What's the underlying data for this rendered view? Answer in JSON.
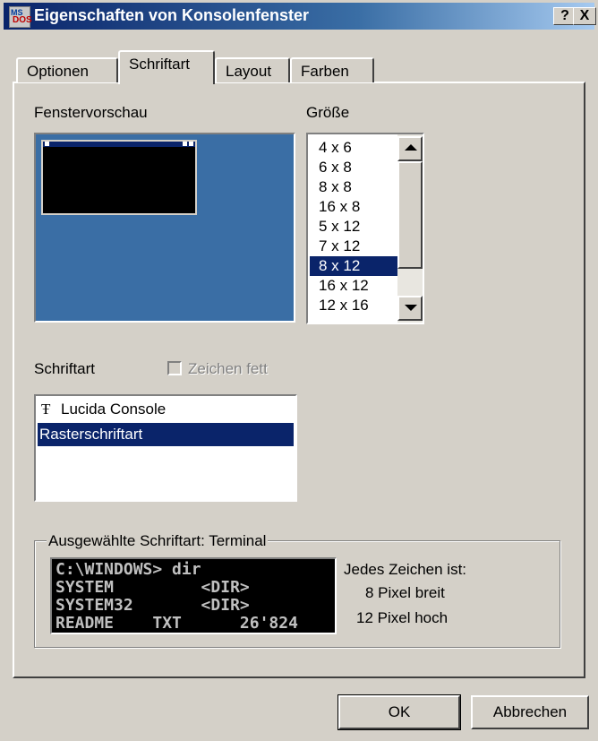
{
  "window": {
    "title": "Eigenschaften von Konsolenfenster",
    "icon_ms": "MS",
    "icon_dos": "DOS",
    "help_label": "?",
    "close_label": "X"
  },
  "tabs": [
    {
      "label": "Optionen",
      "active": false
    },
    {
      "label": "Schriftart",
      "active": true
    },
    {
      "label": "Layout",
      "active": false
    },
    {
      "label": "Farben",
      "active": false
    }
  ],
  "preview": {
    "label": "Fenstervorschau"
  },
  "size": {
    "label": "Größe",
    "items": [
      "4 x 6",
      "6 x 8",
      "8 x 8",
      "16 x 8",
      "5 x 12",
      "7 x 12",
      "8 x 12",
      "16 x 12",
      "12 x 16"
    ],
    "selected": "8 x 12"
  },
  "font": {
    "label": "Schriftart",
    "bold_label": "Zeichen fett",
    "bold_checked": false,
    "items": [
      {
        "name": "Lucida Console",
        "icon": "truetype-icon"
      },
      {
        "name": "Rasterschriftart",
        "icon": ""
      }
    ],
    "selected": "Rasterschriftart"
  },
  "selected_font": {
    "legend": "Ausgewählte Schriftart: Terminal",
    "sample_lines": [
      "C:\\WINDOWS> dir",
      "SYSTEM         <DIR>",
      "SYSTEM32       <DIR>",
      "README    TXT      26'824"
    ],
    "info_heading": "Jedes Zeichen ist:",
    "width_text": "8 Pixel breit",
    "height_text": "12 Pixel hoch"
  },
  "buttons": {
    "ok": "OK",
    "cancel": "Abbrechen"
  },
  "colors": {
    "titlebar_start": "#0a246a",
    "titlebar_end": "#a6caf0",
    "selection": "#0a246a",
    "preview_desktop": "#3a6ea5",
    "dialog_face": "#d4d0c8"
  }
}
